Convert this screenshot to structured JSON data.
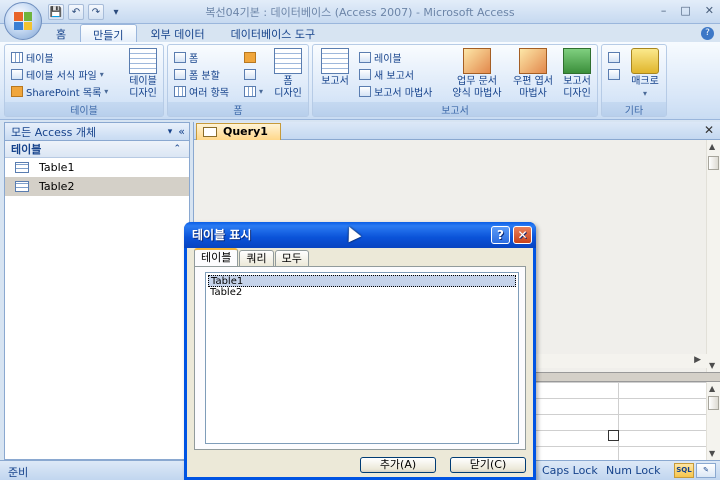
{
  "window": {
    "title": "복선04기본 : 데이터베이스 (Access 2007) - Microsoft Access",
    "controls": [
      "–",
      "□",
      "✕"
    ]
  },
  "qat": {
    "save": "💾",
    "undo": "↶",
    "redo": "↷",
    "more": "▾"
  },
  "ribbon": {
    "tabs": [
      "홈",
      "만들기",
      "외부 데이터",
      "데이터베이스 도구"
    ],
    "active_tab": "만들기",
    "groups": {
      "tables": {
        "label": "테이블",
        "items": [
          "테이블",
          "테이블 서식 파일",
          "SharePoint 목록"
        ],
        "large": "테이블\n디자인"
      },
      "forms": {
        "label": "폼",
        "items": [
          "폼",
          "폼 분할",
          "여러 항목"
        ],
        "large": "폼\n디자인"
      },
      "reports": {
        "label": "보고서",
        "large_report": "보고서",
        "items": [
          "레이블",
          "새 보고서",
          "보고서 마법사"
        ],
        "large_wizard": "업무 문서\n양식 마법사",
        "large_postal": "우편 엽서\n마법사",
        "large_design": "보고서\n디자인"
      },
      "other": {
        "label": "기타",
        "large_macro": "매크로"
      }
    }
  },
  "nav": {
    "header": "모든 Access 개체",
    "section": "테이블",
    "items": [
      "Table1",
      "Table2"
    ],
    "selected": "Table2"
  },
  "document": {
    "tab_label": "Query1"
  },
  "dialog": {
    "title": "테이블 표시",
    "tabs": [
      "테이블",
      "쿼리",
      "모두"
    ],
    "active_tab": "테이블",
    "list": [
      "Table1",
      "Table2"
    ],
    "selected": "Table1",
    "add_button": "추가(A)",
    "close_button": "닫기(C)"
  },
  "status": {
    "ready": "준비",
    "caps": "Caps Lock",
    "num": "Num Lock",
    "sql": "SQL"
  },
  "colors": {
    "accent": "#0054e3",
    "ribbon_text": "#15428b",
    "tab_highlight": "#f2b43a"
  }
}
